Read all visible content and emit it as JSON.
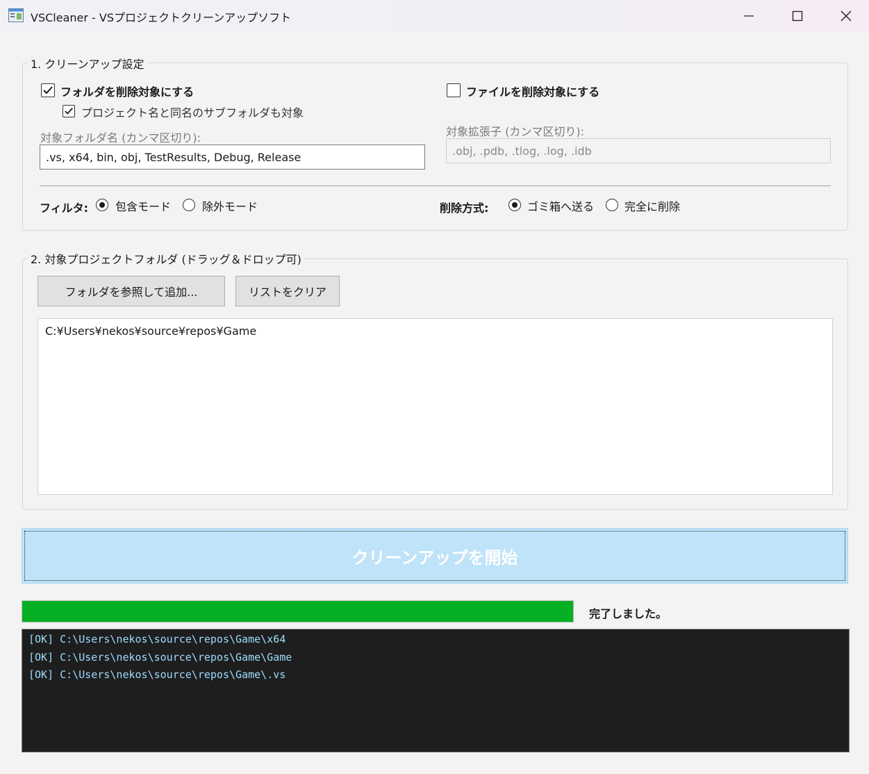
{
  "window": {
    "title": "VSCleaner - VSプロジェクトクリーンアップソフト"
  },
  "cleanup_settings": {
    "group_title": "1. クリーンアップ設定",
    "folders": {
      "checkbox_label": "フォルダを削除対象にする",
      "checked": true,
      "subfolder_label": "プロジェクト名と同名のサブフォルダも対象",
      "subfolder_checked": true,
      "field_label": "対象フォルダ名 (カンマ区切り):",
      "field_value": ".vs, x64, bin, obj, TestResults, Debug, Release"
    },
    "files": {
      "checkbox_label": "ファイルを削除対象にする",
      "checked": false,
      "field_label": "対象拡張子 (カンマ区切り):",
      "field_placeholder": ".obj, .pdb, .tlog, .log, .idb"
    },
    "filter": {
      "label": "フィルタ:",
      "options": [
        "包含モード",
        "除外モード"
      ],
      "selected": "包含モード"
    },
    "delete_method": {
      "label": "削除方式:",
      "options": [
        "ゴミ箱へ送る",
        "完全に削除"
      ],
      "selected": "ゴミ箱へ送る"
    }
  },
  "project_folders": {
    "group_title": "2. 対象プロジェクトフォルダ (ドラッグ＆ドロップ可)",
    "browse_button": "フォルダを参照して追加...",
    "clear_button": "リストをクリア",
    "items": [
      "C:¥Users¥nekos¥source¥repos¥Game"
    ]
  },
  "start_button": "クリーンアップを開始",
  "progress": {
    "percent": 100,
    "status": "完了しました。"
  },
  "log": {
    "lines": [
      "[OK] C:\\Users\\nekos\\source\\repos\\Game\\x64",
      "[OK] C:\\Users\\nekos\\source\\repos\\Game\\Game",
      "[OK] C:\\Users\\nekos\\source\\repos\\Game\\.vs"
    ]
  },
  "colors": {
    "progress_fill": "#06b025",
    "start_button_bg": "#bfe3f8",
    "log_bg": "#1e1e1e",
    "log_text": "#9cdcfe"
  }
}
